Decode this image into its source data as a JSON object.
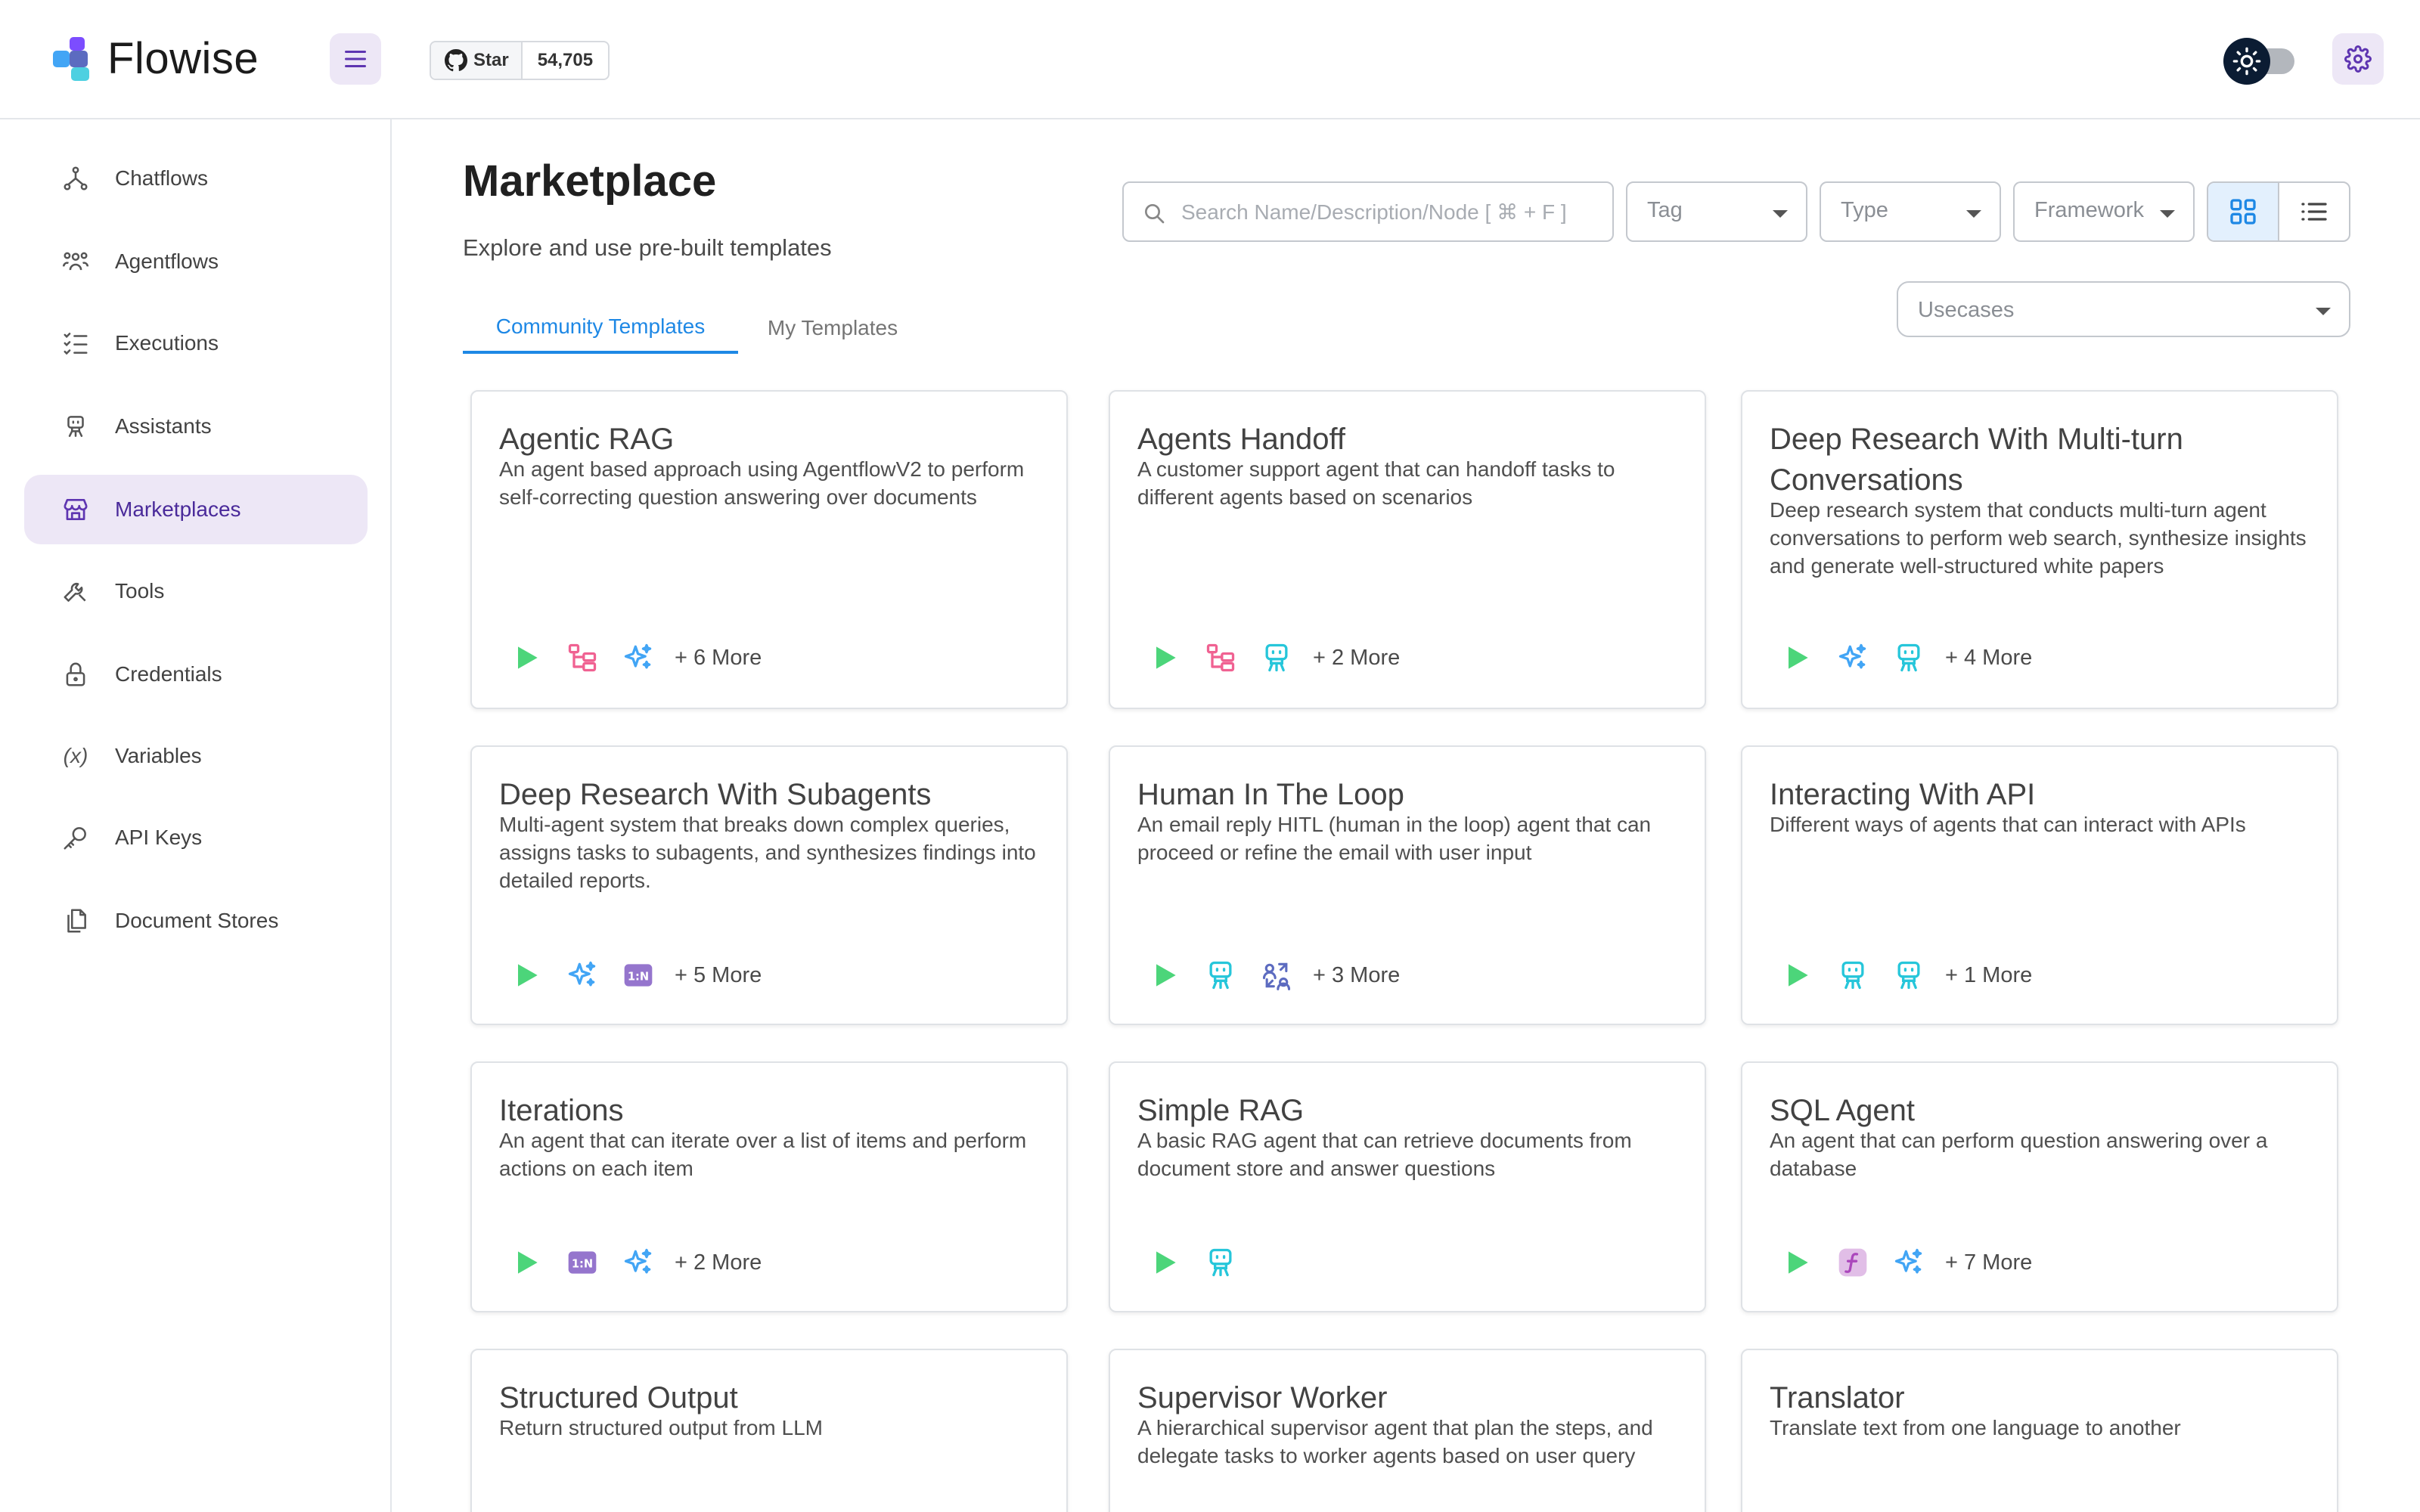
{
  "app": {
    "name": "Flowise"
  },
  "github": {
    "star_label": "Star",
    "count": "54,705"
  },
  "sidebar": {
    "items": [
      {
        "label": "Chatflows",
        "icon": "chatflows-icon"
      },
      {
        "label": "Agentflows",
        "icon": "agentflows-icon"
      },
      {
        "label": "Executions",
        "icon": "executions-icon"
      },
      {
        "label": "Assistants",
        "icon": "assistants-icon"
      },
      {
        "label": "Marketplaces",
        "icon": "marketplace-icon",
        "active": true
      },
      {
        "label": "Tools",
        "icon": "tools-icon"
      },
      {
        "label": "Credentials",
        "icon": "lock-icon"
      },
      {
        "label": "Variables",
        "icon": "variable-icon",
        "glyph": "(x)"
      },
      {
        "label": "API Keys",
        "icon": "key-icon"
      },
      {
        "label": "Document Stores",
        "icon": "files-icon"
      }
    ]
  },
  "page": {
    "title": "Marketplace",
    "subtitle": "Explore and use pre-built templates",
    "tabs": {
      "community": "Community Templates",
      "my": "My Templates"
    }
  },
  "filters": {
    "search_placeholder": "Search Name/Description/Node [ ⌘ + F ]",
    "tag": "Tag",
    "type": "Type",
    "framework": "Framework",
    "usecases": "Usecases"
  },
  "colors": {
    "accent": "#1e88e5",
    "active_bg": "#ede7f6",
    "active_text": "#4a2a9a"
  },
  "cards": [
    {
      "title": "Agentic RAG",
      "desc": "An agent based approach using AgentflowV2 to perform self-correcting question answering over documents",
      "icons": [
        "play-icon",
        "condition-icon",
        "sparkle-icon"
      ],
      "more": "+ 6 More"
    },
    {
      "title": "Agents Handoff",
      "desc": "A customer support agent that can handoff tasks to different agents based on scenarios",
      "icons": [
        "play-icon",
        "condition-icon",
        "robot-icon"
      ],
      "more": "+ 2 More"
    },
    {
      "title": "Deep Research With Multi-turn Conversations",
      "desc": "Deep research system that conducts multi-turn agent conversations to perform web search, synthesize insights and generate well-structured white papers",
      "icons": [
        "play-icon",
        "sparkle-icon",
        "robot-icon"
      ],
      "more": "+ 4 More"
    },
    {
      "title": "Deep Research With Subagents",
      "desc": "Multi-agent system that breaks down complex queries, assigns tasks to subagents, and synthesizes findings into detailed reports.",
      "icons": [
        "play-icon",
        "sparkle-icon",
        "iteration-icon"
      ],
      "more": "+ 5 More"
    },
    {
      "title": "Human In The Loop",
      "desc": "An email reply HITL (human in the loop) agent that can proceed or refine the email with user input",
      "icons": [
        "play-icon",
        "robot-icon",
        "human-loop-icon"
      ],
      "more": "+ 3 More"
    },
    {
      "title": "Interacting With API",
      "desc": "Different ways of agents that can interact with APIs",
      "icons": [
        "play-icon",
        "robot-icon",
        "robot-icon"
      ],
      "more": "+ 1 More"
    },
    {
      "title": "Iterations",
      "desc": "An agent that can iterate over a list of items and perform actions on each item",
      "icons": [
        "play-icon",
        "iteration-icon",
        "sparkle-icon"
      ],
      "more": "+ 2 More"
    },
    {
      "title": "Simple RAG",
      "desc": "A basic RAG agent that can retrieve documents from document store and answer questions",
      "icons": [
        "play-icon",
        "robot-icon"
      ],
      "more": ""
    },
    {
      "title": "SQL Agent",
      "desc": "An agent that can perform question answering over a database",
      "icons": [
        "play-icon",
        "function-icon",
        "sparkle-icon"
      ],
      "more": "+ 7 More"
    },
    {
      "title": "Structured Output",
      "desc": "Return structured output from LLM",
      "icons": [],
      "more": ""
    },
    {
      "title": "Supervisor Worker",
      "desc": "A hierarchical supervisor agent that plan the steps, and delegate tasks to worker agents based on user query",
      "icons": [],
      "more": ""
    },
    {
      "title": "Translator",
      "desc": "Translate text from one language to another",
      "icons": [],
      "more": ""
    }
  ]
}
